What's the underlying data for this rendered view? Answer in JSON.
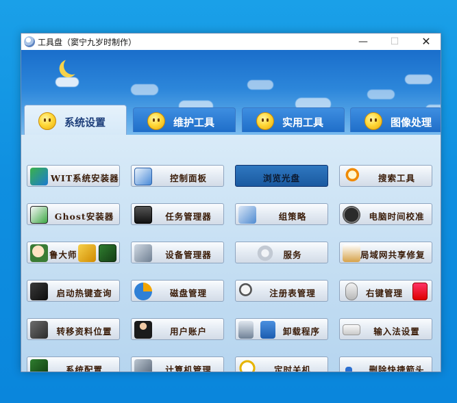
{
  "window": {
    "title": "工具盘（窦宁九岁时制作）",
    "controls": {
      "minimize": "—",
      "maximize": "☐",
      "close": "✕"
    }
  },
  "tabs": [
    {
      "label": "系统设置",
      "active": true
    },
    {
      "label": "维护工具",
      "active": false
    },
    {
      "label": "实用工具",
      "active": false
    },
    {
      "label": "图像处理",
      "active": false
    }
  ],
  "buttons": {
    "row1": [
      "WIT系统安装器",
      "控制面板",
      "浏览光盘",
      "搜索工具"
    ],
    "row2": [
      "Ghost安装器",
      "任务管理器",
      "组策略",
      "电脑时间校准"
    ],
    "row3": [
      "鲁大师",
      "设备管理器",
      "服务",
      "局域网共享修复"
    ],
    "row4": [
      "启动热键查询",
      "磁盘管理",
      "注册表管理",
      "右键管理"
    ],
    "row5": [
      "转移资料位置",
      "用户账户",
      "卸载程序",
      "输入法设置"
    ],
    "row6": [
      "系统配置",
      "计算机管理",
      "定时关机",
      "删除快捷箭头"
    ]
  },
  "selected_button": "浏览光盘",
  "colors": {
    "desktop": "#0f8fe0",
    "tab_active_bg": "#e0eefa",
    "tab_inactive_bg": "#2a7dd3",
    "selected_button_bg": "#2466ae",
    "button_text": "#3a1c08"
  }
}
